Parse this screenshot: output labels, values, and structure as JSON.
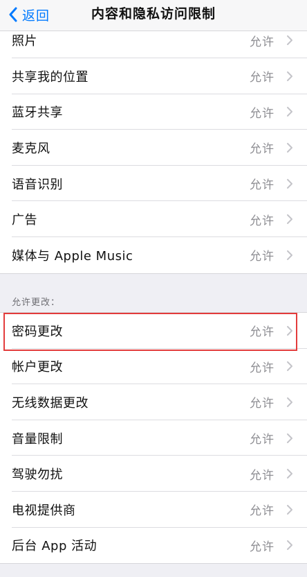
{
  "navbar": {
    "back_label": "返回",
    "title": "内容和隐私访问限制"
  },
  "group1": {
    "items": [
      {
        "label": "照片",
        "value": "允许"
      },
      {
        "label": "共享我的位置",
        "value": "允许"
      },
      {
        "label": "蓝牙共享",
        "value": "允许"
      },
      {
        "label": "麦克风",
        "value": "允许"
      },
      {
        "label": "语音识别",
        "value": "允许"
      },
      {
        "label": "广告",
        "value": "允许"
      },
      {
        "label": "媒体与 Apple Music",
        "value": "允许"
      }
    ]
  },
  "group2": {
    "header": "允许更改：",
    "items": [
      {
        "label": "密码更改",
        "value": "允许"
      },
      {
        "label": "帐户更改",
        "value": "允许"
      },
      {
        "label": "无线数据更改",
        "value": "允许"
      },
      {
        "label": "音量限制",
        "value": "允许"
      },
      {
        "label": "驾驶勿扰",
        "value": "允许"
      },
      {
        "label": "电视提供商",
        "value": "允许"
      },
      {
        "label": "后台 App 活动",
        "value": "允许"
      }
    ]
  },
  "colors": {
    "accent": "#007aff",
    "highlight": "#e33b3b",
    "background": "#efeff4"
  }
}
